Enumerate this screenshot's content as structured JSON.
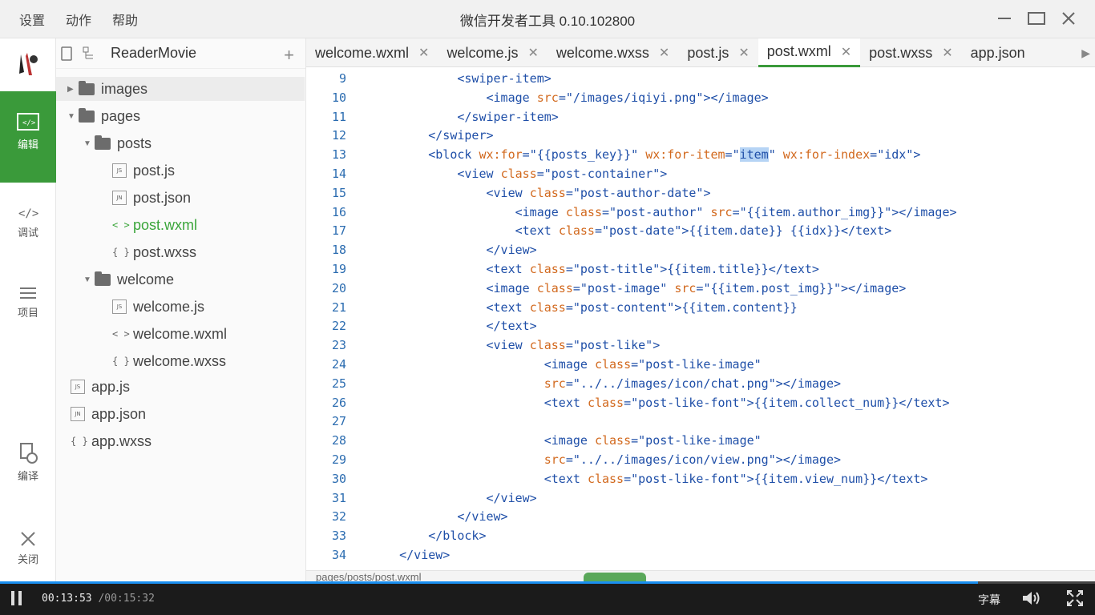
{
  "menu": [
    "设置",
    "动作",
    "帮助"
  ],
  "app_title": "微信开发者工具 0.10.102800",
  "rail": [
    {
      "label": "编辑",
      "icon": "editor-icon",
      "active": true
    },
    {
      "label": "调试",
      "icon": "debug-icon"
    },
    {
      "label": "项目",
      "icon": "project-icon"
    },
    {
      "label": "编译",
      "icon": "compile-icon"
    },
    {
      "label": "关闭",
      "icon": "close-icon"
    }
  ],
  "tree": {
    "project": "ReaderMovie",
    "nodes": [
      {
        "label": "images",
        "type": "folder",
        "expanded": false
      },
      {
        "label": "pages",
        "type": "folder",
        "expanded": true
      },
      {
        "label": "posts",
        "type": "folder",
        "expanded": true
      },
      {
        "label": "post.js",
        "type": "js",
        "badge": "JS"
      },
      {
        "label": "post.json",
        "type": "json",
        "badge": "JN"
      },
      {
        "label": "post.wxml",
        "type": "wxml",
        "glyph": "< >",
        "active": true
      },
      {
        "label": "post.wxss",
        "type": "wxss",
        "glyph": "{ }"
      },
      {
        "label": "welcome",
        "type": "folder",
        "expanded": true
      },
      {
        "label": "welcome.js",
        "type": "js",
        "badge": "JS"
      },
      {
        "label": "welcome.wxml",
        "type": "wxml",
        "glyph": "< >"
      },
      {
        "label": "welcome.wxss",
        "type": "wxss",
        "glyph": "{ }"
      },
      {
        "label": "app.js",
        "type": "js",
        "badge": "JS"
      },
      {
        "label": "app.json",
        "type": "json",
        "badge": "JN"
      },
      {
        "label": "app.wxss",
        "type": "wxss",
        "glyph": "{ }"
      }
    ]
  },
  "tabs": [
    {
      "label": "welcome.wxml"
    },
    {
      "label": "welcome.js"
    },
    {
      "label": "welcome.wxss"
    },
    {
      "label": "post.js"
    },
    {
      "label": "post.wxml",
      "active": true
    },
    {
      "label": "post.wxss"
    },
    {
      "label": "app.json"
    }
  ],
  "code_lines": [
    {
      "n": "9",
      "html": "            <span class='t'>&lt;swiper-item&gt;</span>"
    },
    {
      "n": "10",
      "html": "                <span class='t'>&lt;image</span> <span class='a'>src</span>=<span class='s'>\"/images/iqiyi.png\"</span><span class='t'>&gt;&lt;/image&gt;</span>"
    },
    {
      "n": "11",
      "html": "            <span class='t'>&lt;/swiper-item&gt;</span>"
    },
    {
      "n": "12",
      "html": "        <span class='t'>&lt;/swiper&gt;</span>"
    },
    {
      "n": "13",
      "html": "        <span class='t'>&lt;block</span> <span class='a'>wx:for</span>=<span class='s'>\"{{posts_key}}\"</span> <span class='a'>wx:for-item</span>=<span class='s'>\"<span class='hl'>item</span>\"</span> <span class='a'>wx:for-index</span>=<span class='s'>\"idx\"</span><span class='t'>&gt;</span>"
    },
    {
      "n": "14",
      "html": "            <span class='t'>&lt;view</span> <span class='a'>class</span>=<span class='s'>\"post-container\"</span><span class='t'>&gt;</span>"
    },
    {
      "n": "15",
      "html": "                <span class='t'>&lt;view</span> <span class='a'>class</span>=<span class='s'>\"post-author-date\"</span><span class='t'>&gt;</span>"
    },
    {
      "n": "16",
      "html": "                    <span class='t'>&lt;image</span> <span class='a'>class</span>=<span class='s'>\"post-author\"</span> <span class='a'>src</span>=<span class='s'>\"{{item.author_img}}\"</span><span class='t'>&gt;&lt;/image&gt;</span>"
    },
    {
      "n": "17",
      "html": "                    <span class='t'>&lt;text</span> <span class='a'>class</span>=<span class='s'>\"post-date\"</span><span class='t'>&gt;</span>{{item.date}} {{idx}}<span class='t'>&lt;/text&gt;</span>"
    },
    {
      "n": "18",
      "html": "                <span class='t'>&lt;/view&gt;</span>"
    },
    {
      "n": "19",
      "html": "                <span class='t'>&lt;text</span> <span class='a'>class</span>=<span class='s'>\"post-title\"</span><span class='t'>&gt;</span>{{item.title}}<span class='t'>&lt;/text&gt;</span>"
    },
    {
      "n": "20",
      "html": "                <span class='t'>&lt;image</span> <span class='a'>class</span>=<span class='s'>\"post-image\"</span> <span class='a'>src</span>=<span class='s'>\"{{item.post_img}}\"</span><span class='t'>&gt;&lt;/image&gt;</span>"
    },
    {
      "n": "21",
      "html": "                <span class='t'>&lt;text</span> <span class='a'>class</span>=<span class='s'>\"post-content\"</span><span class='t'>&gt;</span>{{item.content}}"
    },
    {
      "n": "22",
      "html": "                <span class='t'>&lt;/text&gt;</span>"
    },
    {
      "n": "23",
      "html": "                <span class='t'>&lt;view</span> <span class='a'>class</span>=<span class='s'>\"post-like\"</span><span class='t'>&gt;</span>"
    },
    {
      "n": "24",
      "html": "                        <span class='t'>&lt;image</span> <span class='a'>class</span>=<span class='s'>\"post-like-image\"</span>"
    },
    {
      "n": "25",
      "html": "                        <span class='a'>src</span>=<span class='s'>\"../../images/icon/chat.png\"</span><span class='t'>&gt;&lt;/image&gt;</span>"
    },
    {
      "n": "26",
      "html": "                        <span class='t'>&lt;text</span> <span class='a'>class</span>=<span class='s'>\"post-like-font\"</span><span class='t'>&gt;</span>{{item.collect_num}}<span class='t'>&lt;/text&gt;</span>"
    },
    {
      "n": "27",
      "html": ""
    },
    {
      "n": "28",
      "html": "                        <span class='t'>&lt;image</span> <span class='a'>class</span>=<span class='s'>\"post-like-image\"</span>"
    },
    {
      "n": "29",
      "html": "                        <span class='a'>src</span>=<span class='s'>\"../../images/icon/view.png\"</span><span class='t'>&gt;&lt;/image&gt;</span>"
    },
    {
      "n": "30",
      "html": "                        <span class='t'>&lt;text</span> <span class='a'>class</span>=<span class='s'>\"post-like-font\"</span><span class='t'>&gt;</span>{{item.view_num}}<span class='t'>&lt;/text&gt;</span>"
    },
    {
      "n": "31",
      "html": "                <span class='t'>&lt;/view&gt;</span>"
    },
    {
      "n": "32",
      "html": "            <span class='t'>&lt;/view&gt;</span>"
    },
    {
      "n": "33",
      "html": "        <span class='t'>&lt;/block&gt;</span>"
    },
    {
      "n": "34",
      "html": "    <span class='t'>&lt;/view&gt;</span>"
    }
  ],
  "status_path": "pages/posts/post.wxml",
  "player": {
    "current": "00:13:53",
    "total": "/00:15:32",
    "subtitles": "字幕",
    "progress": 0.893
  },
  "colors": {
    "accent": "#3a9a3a",
    "progress": "#1a8ff0"
  }
}
